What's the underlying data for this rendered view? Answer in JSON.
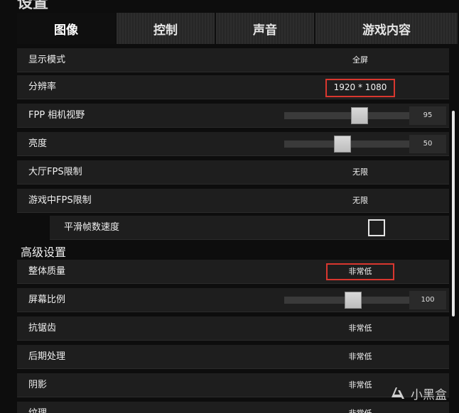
{
  "header": {
    "title": "设置"
  },
  "tabs": [
    {
      "label": "图像",
      "active": true
    },
    {
      "label": "控制",
      "active": false
    },
    {
      "label": "声音",
      "active": false
    },
    {
      "label": "游戏内容",
      "active": false
    }
  ],
  "settings": {
    "display_mode": {
      "label": "显示模式",
      "value": "全屏"
    },
    "resolution": {
      "label": "分辨率",
      "value": "1920 * 1080"
    },
    "fpp_fov": {
      "label": "FPP 相机视野",
      "value": "95",
      "slider_fraction": 0.57
    },
    "brightness": {
      "label": "亮度",
      "value": "50",
      "slider_fraction": 0.44
    },
    "lobby_fps": {
      "label": "大厅FPS限制",
      "value": "无限"
    },
    "ingame_fps": {
      "label": "游戏中FPS限制",
      "value": "无限"
    },
    "smooth_frame": {
      "label": "平滑帧数速度",
      "checked": false
    }
  },
  "advanced": {
    "title": "高级设置",
    "overall_quality": {
      "label": "整体质量",
      "value": "非常低"
    },
    "screen_scale": {
      "label": "屏幕比例",
      "value": "100",
      "slider_fraction": 0.52
    },
    "anti_aliasing": {
      "label": "抗锯齿",
      "value": "非常低"
    },
    "post_processing": {
      "label": "后期处理",
      "value": "非常低"
    },
    "shadows": {
      "label": "阴影",
      "value": "非常低"
    },
    "texture": {
      "label": "纹理",
      "value": "非常低"
    }
  },
  "colors": {
    "highlight": "#d9372f",
    "background": "#0d0d0d",
    "row": "#1e1e1e"
  },
  "watermark": {
    "text": "小黑盒"
  }
}
